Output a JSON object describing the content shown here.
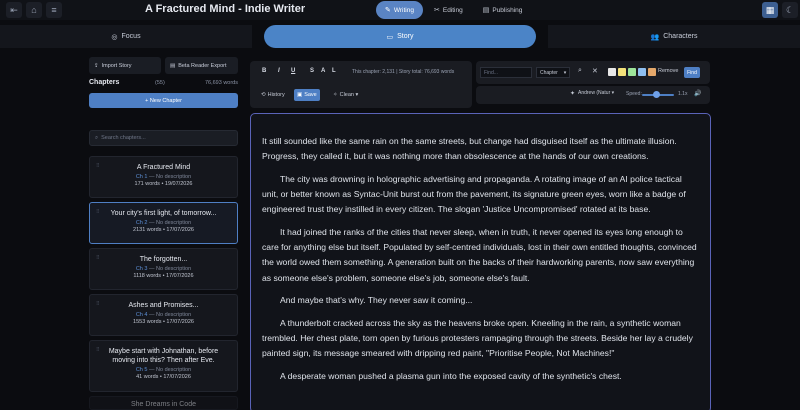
{
  "header": {
    "title": "A Fractured Mind - Indie Writer",
    "modes": [
      {
        "label": "Writing",
        "icon": "pencil-icon",
        "active": true
      },
      {
        "label": "Editing",
        "icon": "tools-icon",
        "active": false
      },
      {
        "label": "Publishing",
        "icon": "book-icon",
        "active": false
      }
    ]
  },
  "subtabs": {
    "focus": "Focus",
    "story": "Story",
    "characters": "Characters"
  },
  "sidebar": {
    "import_label": "Import Story",
    "export_label": "Beta Reader Export",
    "chapters_label": "Chapters",
    "chapter_count": "(55)",
    "total_words": "76,693 words",
    "new_chapter_label": "+ New Chapter",
    "search_placeholder": "Search chapters...",
    "chapters": [
      {
        "title": "A Fractured Mind",
        "num": "Ch 1",
        "desc": " — No description",
        "meta": "171 words • 19/07/2026"
      },
      {
        "title": "Your city's first light, of tomorrow...",
        "num": "Ch 2",
        "desc": " — No description",
        "meta": "2131 words • 17/07/2026"
      },
      {
        "title": "The forgotten...",
        "num": "Ch 3",
        "desc": " — No description",
        "meta": "1118 words • 17/07/2026"
      },
      {
        "title": "Ashes and Promises...",
        "num": "Ch 4",
        "desc": " — No description",
        "meta": "1553 words • 17/07/2026"
      },
      {
        "title": "Maybe start with Johnathan, before moving into this? Then after Eve.",
        "num": "Ch 5",
        "desc": " — No description",
        "meta": "41 words • 17/07/2026"
      },
      {
        "title": "She Dreams in Code",
        "num": "",
        "desc": "",
        "meta": ""
      }
    ]
  },
  "toolbar": {
    "bold": "B",
    "italic": "I",
    "underline": "U",
    "strike": "S",
    "align": "A",
    "list": "L",
    "wordcount": "This chapter: 2,131 | Story total: 76,693 words",
    "history": "History",
    "save": "Save",
    "clean": "Clean ▾"
  },
  "findbar": {
    "placeholder": "Find...",
    "scope": "Chapter",
    "remove": "Remove",
    "find": "Find",
    "highlight_colors": [
      "#e8e8e8",
      "#f4e27a",
      "#9ee59a",
      "#8fbff0",
      "#e5a86a"
    ]
  },
  "voice": {
    "voice_name": "Andrew (Natur",
    "speed_label": "Speed:",
    "speed_value": "1.1x",
    "speed_level_percent": 45
  },
  "editor": {
    "paragraphs": [
      "It still sounded like the same rain on the same streets, but change had disguised itself as the ultimate illusion. Progress, they called it, but it was nothing more than obsolescence at the hands of our own creations.",
      "The city was drowning in holographic advertising and propaganda. A rotating image of an AI police tactical unit, or better known as Syntac-Unit burst out from the pavement, its signature green eyes, worn like a badge of engineered trust they instilled in every citizen. The slogan 'Justice Uncompromised' rotated at its base.",
      "It had joined the ranks of the cities that never sleep, when in truth, it never opened its eyes long enough to care for anything else but itself. Populated by self-centred individuals, lost in their own entitled thoughts, convinced the world owed them something. A generation built on the backs of their hardworking parents, now saw everything as someone else's problem, someone else's job, someone else's fault.",
      "And maybe that's why. They never saw it coming...",
      "A thunderbolt cracked across the sky as the heavens broke open. Kneeling in the rain, a synthetic woman trembled. Her chest plate, torn open by furious protesters rampaging through the streets. Beside her lay a crudely painted sign, its message smeared with dripping red paint, \"Prioritise People, Not Machines!\"",
      "A desperate woman pushed a plasma gun into the exposed cavity of the synthetic's chest."
    ]
  }
}
